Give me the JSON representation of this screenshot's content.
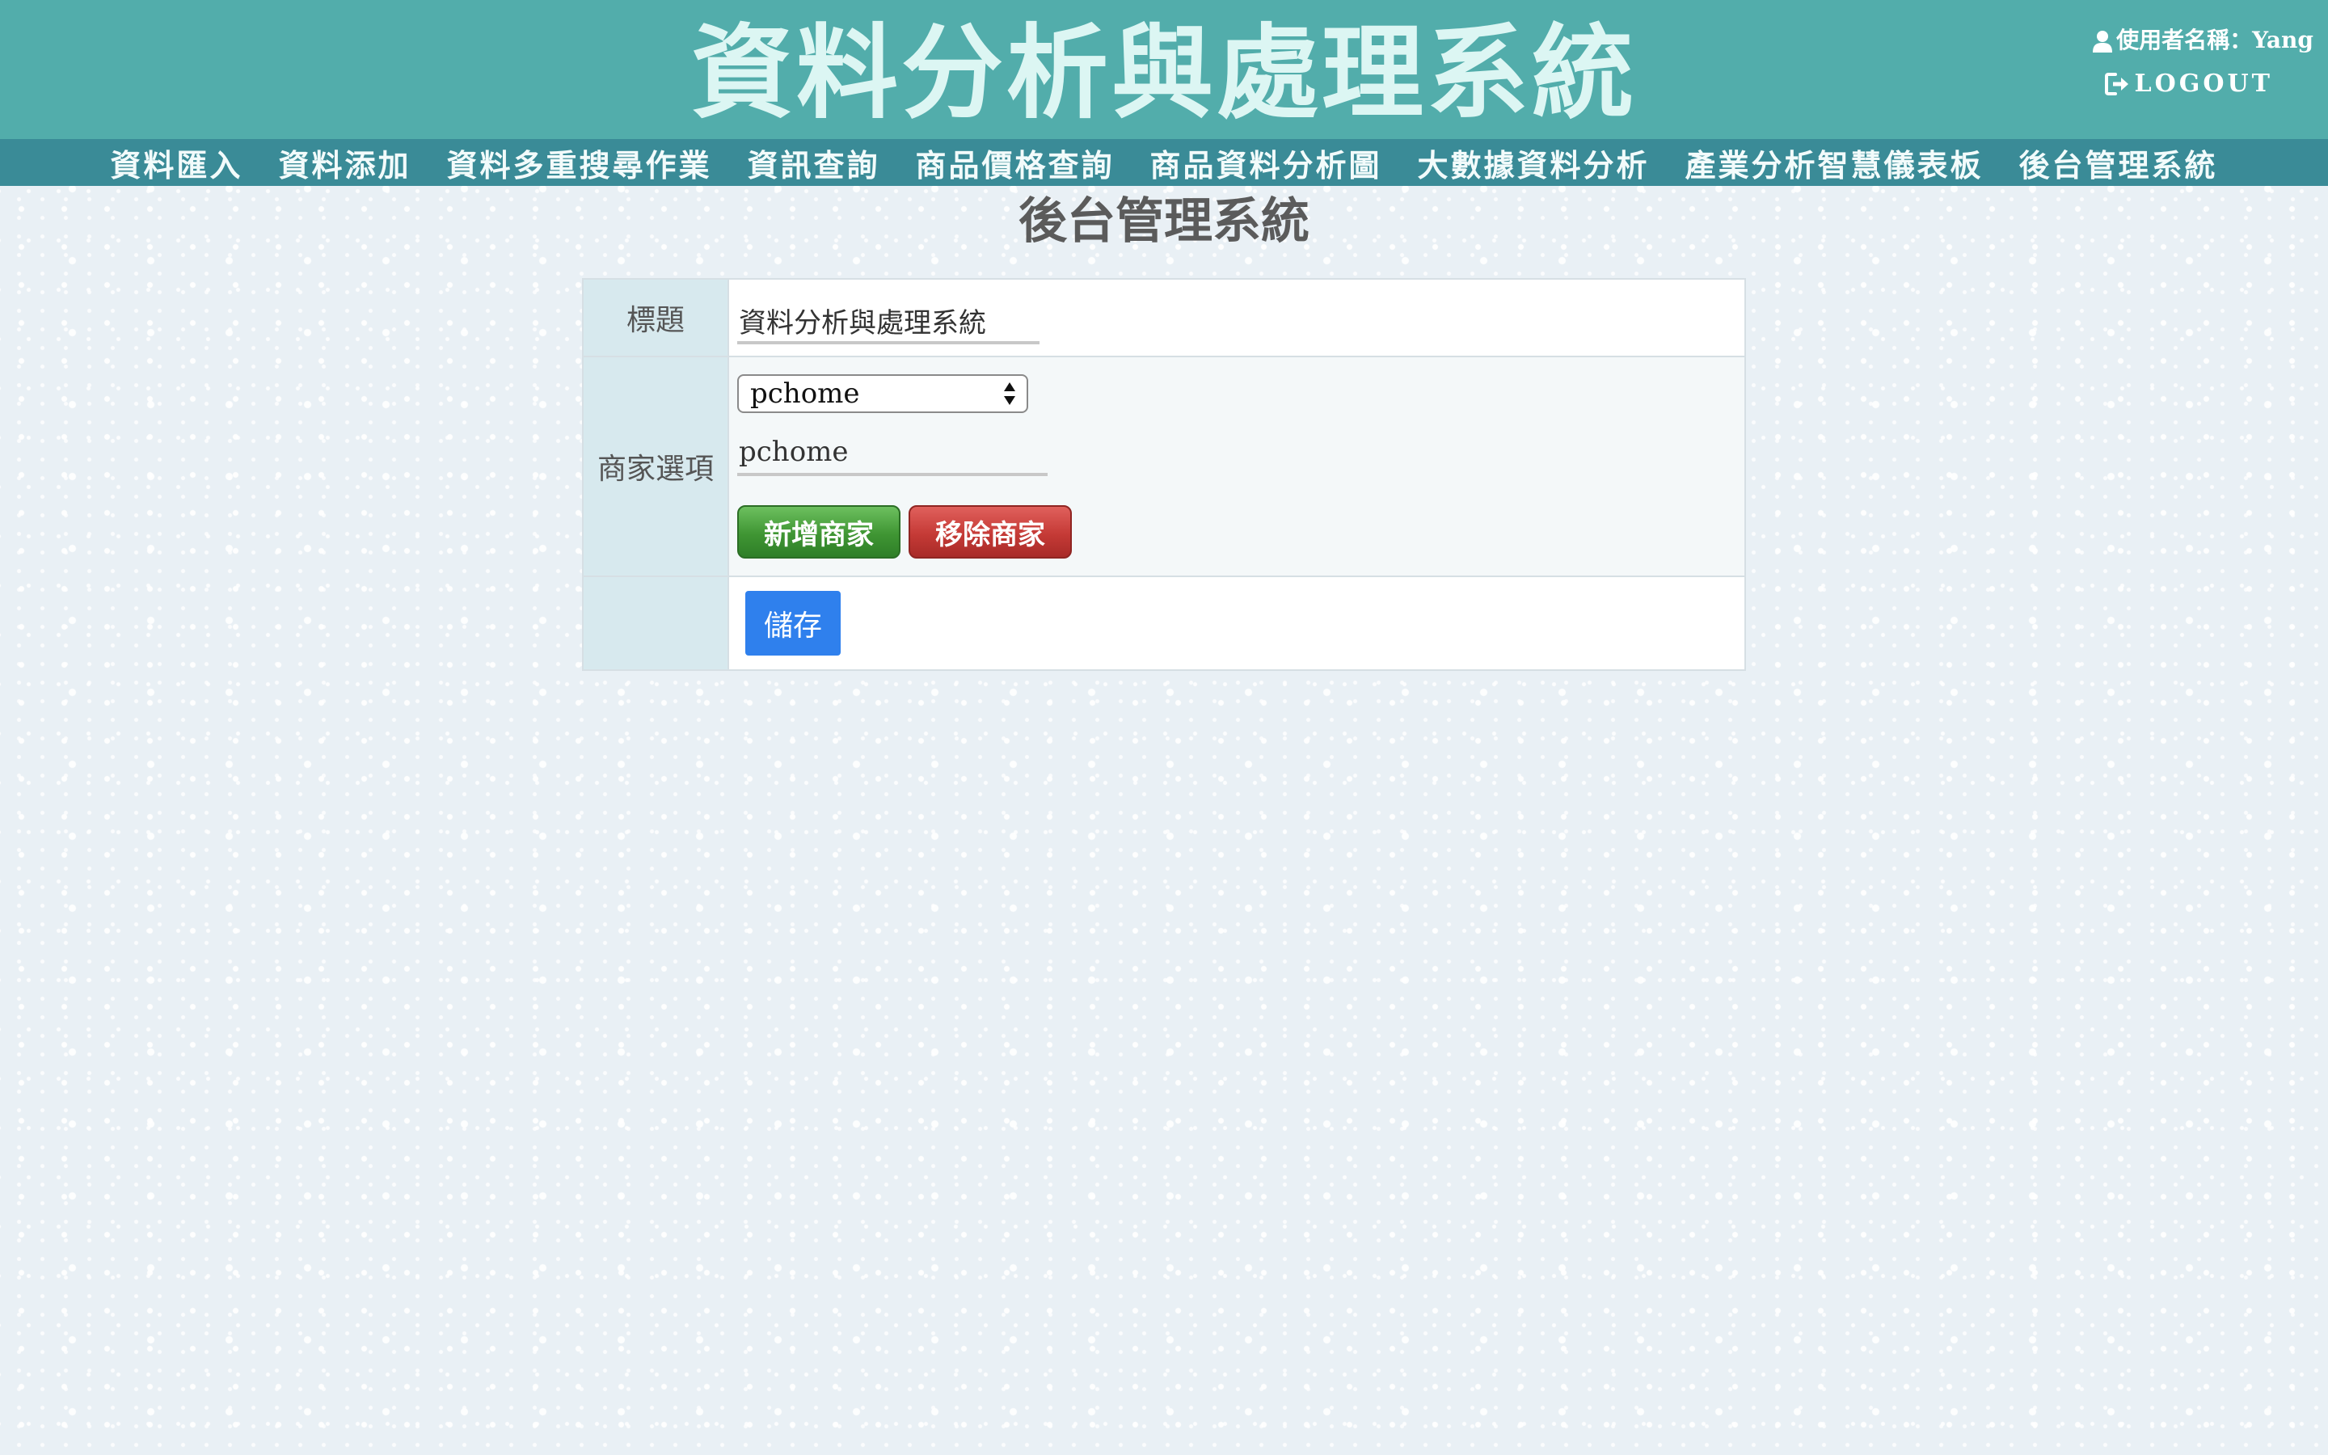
{
  "header": {
    "title": "資料分析與處理系統",
    "user_label": "使用者名稱：Yang",
    "logout_label": "LOGOUT"
  },
  "nav": {
    "items": [
      "資料匯入",
      "資料添加",
      "資料多重搜尋作業",
      "資訊查詢",
      "商品價格查詢",
      "商品資料分析圖",
      "大數據資料分析",
      "產業分析智慧儀表板",
      "後台管理系統"
    ]
  },
  "main": {
    "heading": "後台管理系統",
    "title_row": {
      "label": "標題",
      "value": "資料分析與處理系統"
    },
    "merchant_row": {
      "label": "商家選項",
      "selected": "pchome",
      "input_value": "pchome",
      "add_button": "新增商家",
      "remove_button": "移除商家"
    },
    "save_button": "儲存"
  },
  "colors": {
    "header_bg": "#52adab",
    "nav_bg": "#3a8b97",
    "save_blue": "#2f80ed",
    "add_green": "#3f9533",
    "remove_red": "#c53a36"
  },
  "icons": {
    "user": "user-icon",
    "logout": "logout-icon",
    "select_arrows": "up-down-arrows-icon"
  }
}
